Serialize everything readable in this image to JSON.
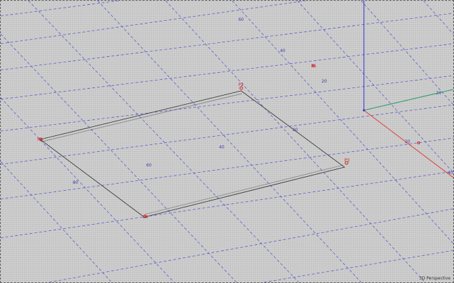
{
  "viewport": {
    "view_name": "3D Perspective",
    "grid_labels": [
      "60",
      "40",
      "20",
      "20",
      "40",
      "60",
      "80",
      "20",
      "20",
      "40"
    ],
    "vertex_labels": [
      "P1",
      "P2",
      "P3",
      "P4",
      "P5"
    ],
    "colors": {
      "background": "#cfcfcf",
      "grid": "#5c5ccc",
      "axis_z": "#2a2ad8",
      "axis_x": "#e03a3a",
      "axis_y": "#2a9a6a",
      "vertex": "#d21f1f",
      "edge": "#3a3a3a"
    }
  }
}
